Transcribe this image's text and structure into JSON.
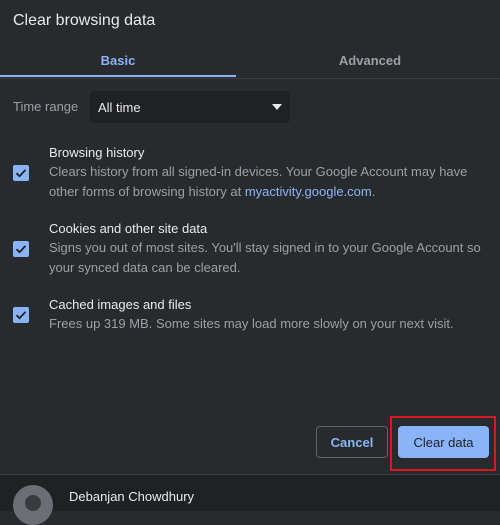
{
  "dialog": {
    "title": "Clear browsing data"
  },
  "tabs": [
    {
      "label": "Basic"
    },
    {
      "label": "Advanced"
    }
  ],
  "time_range": {
    "label": "Time range",
    "value": "All time"
  },
  "options": [
    {
      "title": "Browsing history",
      "desc_before": "Clears history from all signed-in devices. Your Google Account may have other forms of browsing history at ",
      "link": "myactivity.google.com",
      "desc_after": ".",
      "checked": true
    },
    {
      "title": "Cookies and other site data",
      "desc": "Signs you out of most sites. You'll stay signed in to your Google Account so your synced data can be cleared.",
      "checked": true
    },
    {
      "title": "Cached images and files",
      "desc": "Frees up 319 MB. Some sites may load more slowly on your next visit.",
      "checked": true
    }
  ],
  "buttons": {
    "cancel": "Cancel",
    "clear": "Clear data"
  },
  "footer": {
    "user_name": "Debanjan Chowdhury"
  },
  "colors": {
    "accent": "#8ab4f8",
    "highlight": "#d71920",
    "background": "#292a2d"
  }
}
